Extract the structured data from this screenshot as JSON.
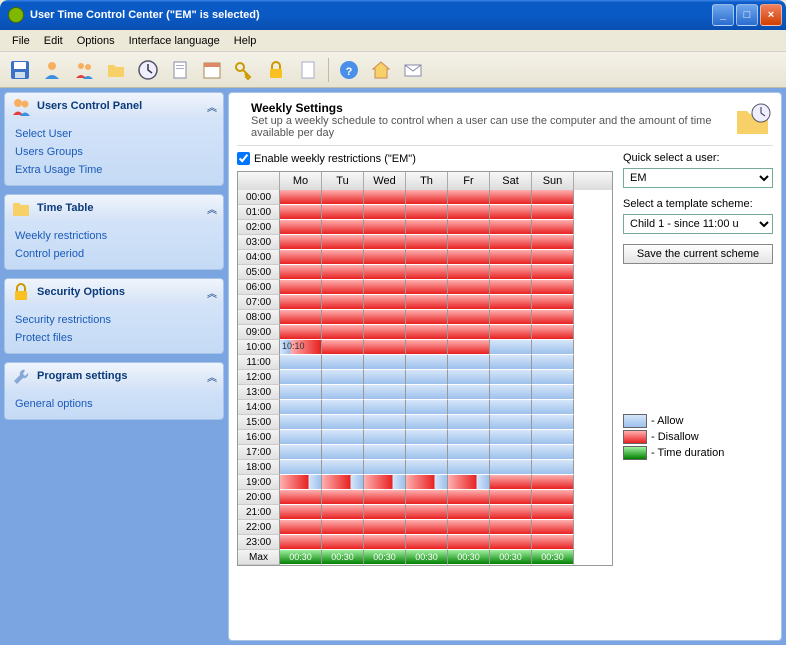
{
  "window": {
    "title": "User Time Control Center (\"EM\" is selected)"
  },
  "menu": {
    "file": "File",
    "edit": "Edit",
    "options": "Options",
    "lang": "Interface language",
    "help": "Help"
  },
  "sidebar": {
    "users": {
      "title": "Users Control Panel",
      "items": [
        "Select User",
        "Users Groups",
        "Extra Usage Time"
      ]
    },
    "time": {
      "title": "Time Table",
      "items": [
        "Weekly restrictions",
        "Control period"
      ]
    },
    "security": {
      "title": "Security Options",
      "items": [
        "Security restrictions",
        "Protect files"
      ]
    },
    "program": {
      "title": "Program settings",
      "items": [
        "General options"
      ]
    }
  },
  "main": {
    "heading": "Weekly Settings",
    "desc": "Set up a weekly schedule to control when a user can use the computer and the amount of time available per day",
    "enable_label": "Enable weekly restrictions (\"EM\")",
    "quick_label": "Quick select a user:",
    "quick_value": "EM",
    "template_label": "Select a template scheme:",
    "template_value": "Child 1  - since 11:00 u",
    "save_btn": "Save the current scheme",
    "days": [
      "Mo",
      "Tu",
      "Wed",
      "Th",
      "Fr",
      "Sat",
      "Sun"
    ],
    "hours": [
      "00:00",
      "01:00",
      "02:00",
      "03:00",
      "04:00",
      "05:00",
      "06:00",
      "07:00",
      "08:00",
      "09:00",
      "10:00",
      "11:00",
      "12:00",
      "13:00",
      "14:00",
      "15:00",
      "16:00",
      "17:00",
      "18:00",
      "19:00",
      "20:00",
      "21:00",
      "22:00",
      "23:00"
    ],
    "max_label": "Max",
    "max_values": [
      "00:30",
      "00:30",
      "00:30",
      "00:30",
      "00:30",
      "00:30",
      "00:30"
    ],
    "cell_note": "10:10",
    "legend": {
      "allow": "- Allow",
      "disallow": "- Disallow",
      "time": "- Time duration"
    }
  },
  "schedule_state": {
    "comment": "Per-hour states for 7 days: D=disallow A=allow P=partial (mo 10:00 row), P2=partial (19:00 weekdays)",
    "rows": [
      [
        "D",
        "D",
        "D",
        "D",
        "D",
        "D",
        "D"
      ],
      [
        "D",
        "D",
        "D",
        "D",
        "D",
        "D",
        "D"
      ],
      [
        "D",
        "D",
        "D",
        "D",
        "D",
        "D",
        "D"
      ],
      [
        "D",
        "D",
        "D",
        "D",
        "D",
        "D",
        "D"
      ],
      [
        "D",
        "D",
        "D",
        "D",
        "D",
        "D",
        "D"
      ],
      [
        "D",
        "D",
        "D",
        "D",
        "D",
        "D",
        "D"
      ],
      [
        "D",
        "D",
        "D",
        "D",
        "D",
        "D",
        "D"
      ],
      [
        "D",
        "D",
        "D",
        "D",
        "D",
        "D",
        "D"
      ],
      [
        "D",
        "D",
        "D",
        "D",
        "D",
        "D",
        "D"
      ],
      [
        "D",
        "D",
        "D",
        "D",
        "D",
        "D",
        "D"
      ],
      [
        "P",
        "D",
        "D",
        "D",
        "D",
        "A",
        "A"
      ],
      [
        "A",
        "A",
        "A",
        "A",
        "A",
        "A",
        "A"
      ],
      [
        "A",
        "A",
        "A",
        "A",
        "A",
        "A",
        "A"
      ],
      [
        "A",
        "A",
        "A",
        "A",
        "A",
        "A",
        "A"
      ],
      [
        "A",
        "A",
        "A",
        "A",
        "A",
        "A",
        "A"
      ],
      [
        "A",
        "A",
        "A",
        "A",
        "A",
        "A",
        "A"
      ],
      [
        "A",
        "A",
        "A",
        "A",
        "A",
        "A",
        "A"
      ],
      [
        "A",
        "A",
        "A",
        "A",
        "A",
        "A",
        "A"
      ],
      [
        "A",
        "A",
        "A",
        "A",
        "A",
        "A",
        "A"
      ],
      [
        "P2",
        "P2",
        "P2",
        "P2",
        "P2",
        "D",
        "D"
      ],
      [
        "D",
        "D",
        "D",
        "D",
        "D",
        "D",
        "D"
      ],
      [
        "D",
        "D",
        "D",
        "D",
        "D",
        "D",
        "D"
      ],
      [
        "D",
        "D",
        "D",
        "D",
        "D",
        "D",
        "D"
      ],
      [
        "D",
        "D",
        "D",
        "D",
        "D",
        "D",
        "D"
      ]
    ]
  }
}
